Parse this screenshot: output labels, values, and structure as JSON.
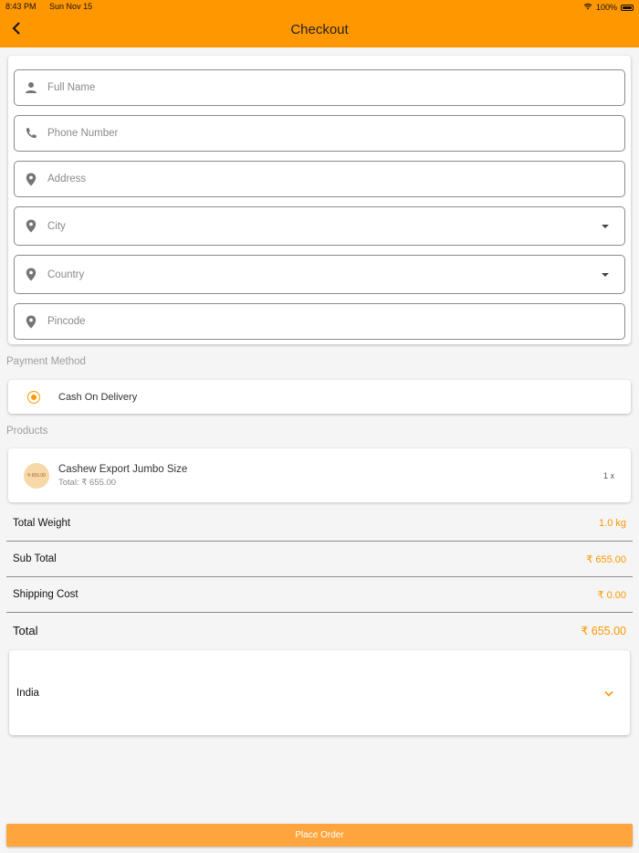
{
  "status_bar": {
    "time": "8:43 PM",
    "date": "Sun Nov 15",
    "battery": "100%"
  },
  "header": {
    "title": "Checkout",
    "back_icon": "chevron-left-icon"
  },
  "form": {
    "full_name": {
      "placeholder": "Full Name",
      "icon": "person-icon"
    },
    "phone": {
      "placeholder": "Phone Number",
      "icon": "phone-icon"
    },
    "address": {
      "placeholder": "Address",
      "icon": "location-pin-icon"
    },
    "city": {
      "placeholder": "City",
      "icon": "location-pin-icon"
    },
    "country": {
      "placeholder": "Country",
      "icon": "location-pin-icon"
    },
    "pincode": {
      "placeholder": "Pincode",
      "icon": "location-pin-icon"
    }
  },
  "payment": {
    "section_label": "Payment Method",
    "options": [
      {
        "label": "Cash On Delivery",
        "selected": true
      }
    ]
  },
  "products": {
    "section_label": "Products",
    "items": [
      {
        "name": "Cashew Export Jumbo Size",
        "total": "Total: ₹ 655.00",
        "qty": "1 x",
        "thumb_text": "₹ 655.00"
      }
    ]
  },
  "summary": {
    "total_weight": {
      "label": "Total Weight",
      "value": "1.0 kg"
    },
    "sub_total": {
      "label": "Sub Total",
      "value": "₹ 655.00"
    },
    "shipping": {
      "label": "Shipping Cost",
      "value": "₹ 0.00"
    },
    "total": {
      "label": "Total",
      "value": "₹ 655.00"
    }
  },
  "country_select": {
    "value": "India"
  },
  "place_order": {
    "label": "Place Order"
  },
  "colors": {
    "accent": "#ff9800",
    "button": "#ffa53d",
    "background": "#f5f5f5"
  }
}
